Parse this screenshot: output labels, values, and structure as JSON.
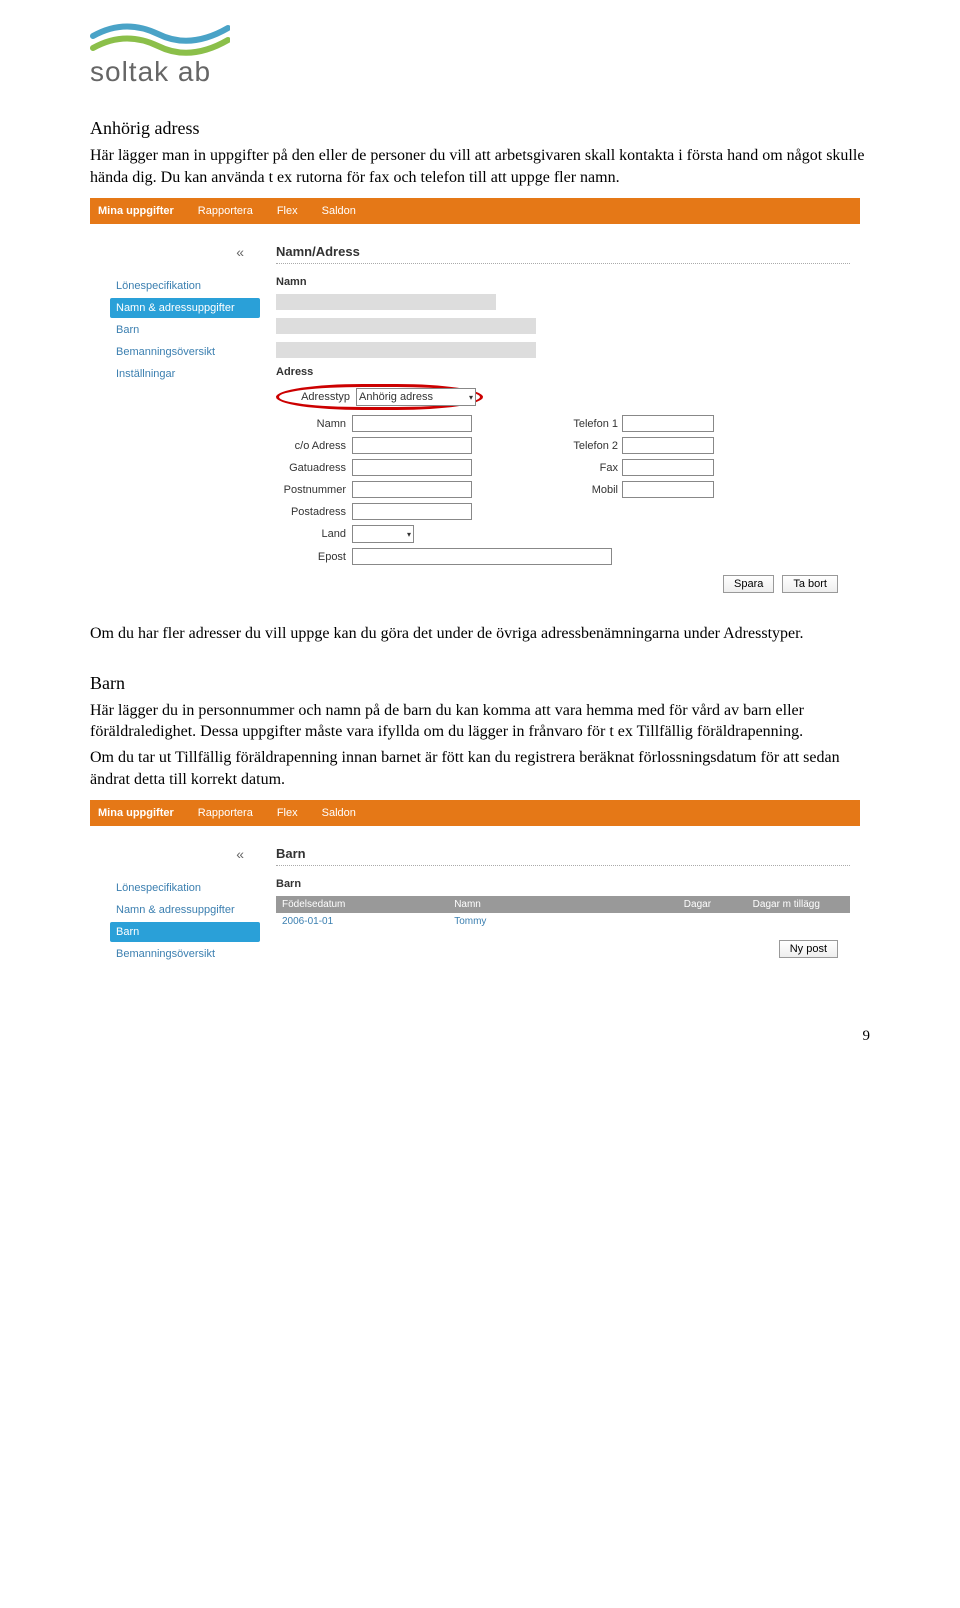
{
  "logo": {
    "text": "soltak ab"
  },
  "section1": {
    "title": "Anhörig adress",
    "p1": "Här lägger man in uppgifter på den eller de personer du vill att arbetsgivaren skall kontakta i första hand om något skulle hända dig. Du kan använda t ex rutorna för fax och telefon till att uppge fler namn."
  },
  "screenshot1": {
    "menubar": [
      "Mina uppgifter",
      "Rapportera",
      "Flex",
      "Saldon"
    ],
    "sidebar": {
      "collapse": "«",
      "items": [
        "Lönespecifikation",
        "Namn & adressuppgifter",
        "Barn",
        "Bemanningsöversikt",
        "Inställningar"
      ],
      "active_index": 1
    },
    "content": {
      "title": "Namn/Adress",
      "sub_namn": "Namn",
      "sub_adress": "Adress",
      "lbl_adresstyp": "Adresstyp",
      "val_adresstyp": "Anhörig adress",
      "labels_left": [
        "Namn",
        "c/o Adress",
        "Gatuadress",
        "Postnummer",
        "Postadress",
        "Land",
        "Epost"
      ],
      "labels_right": [
        "Telefon 1",
        "Telefon 2",
        "Fax",
        "Mobil"
      ],
      "btn_save": "Spara",
      "btn_delete": "Ta bort"
    }
  },
  "between_text": "Om du har fler adresser du vill uppge kan du göra det under de övriga adressbenämningarna under Adresstyper.",
  "section2": {
    "title": "Barn",
    "p1": "Här lägger du in personnummer och namn på de barn du kan komma att vara hemma med för vård av barn eller föräldraledighet. Dessa uppgifter måste vara ifyllda om du lägger in frånvaro för t ex Tillfällig föräldrapenning.",
    "p2": "Om du tar ut Tillfällig föräldrapenning innan barnet är fött kan du registrera beräknat förlossningsdatum för att sedan ändrat detta till korrekt datum."
  },
  "screenshot2": {
    "menubar": [
      "Mina uppgifter",
      "Rapportera",
      "Flex",
      "Saldon"
    ],
    "sidebar": {
      "collapse": "«",
      "items": [
        "Lönespecifikation",
        "Namn & adressuppgifter",
        "Barn",
        "Bemanningsöversikt"
      ],
      "active_index": 2
    },
    "content": {
      "title": "Barn",
      "sub_barn": "Barn",
      "table": {
        "headers": [
          "Födelsedatum",
          "Namn",
          "Dagar",
          "Dagar m tillägg"
        ],
        "rows": [
          [
            "2006-01-01",
            "Tommy",
            "",
            ""
          ]
        ]
      },
      "btn_new": "Ny post"
    }
  },
  "page_number": "9"
}
